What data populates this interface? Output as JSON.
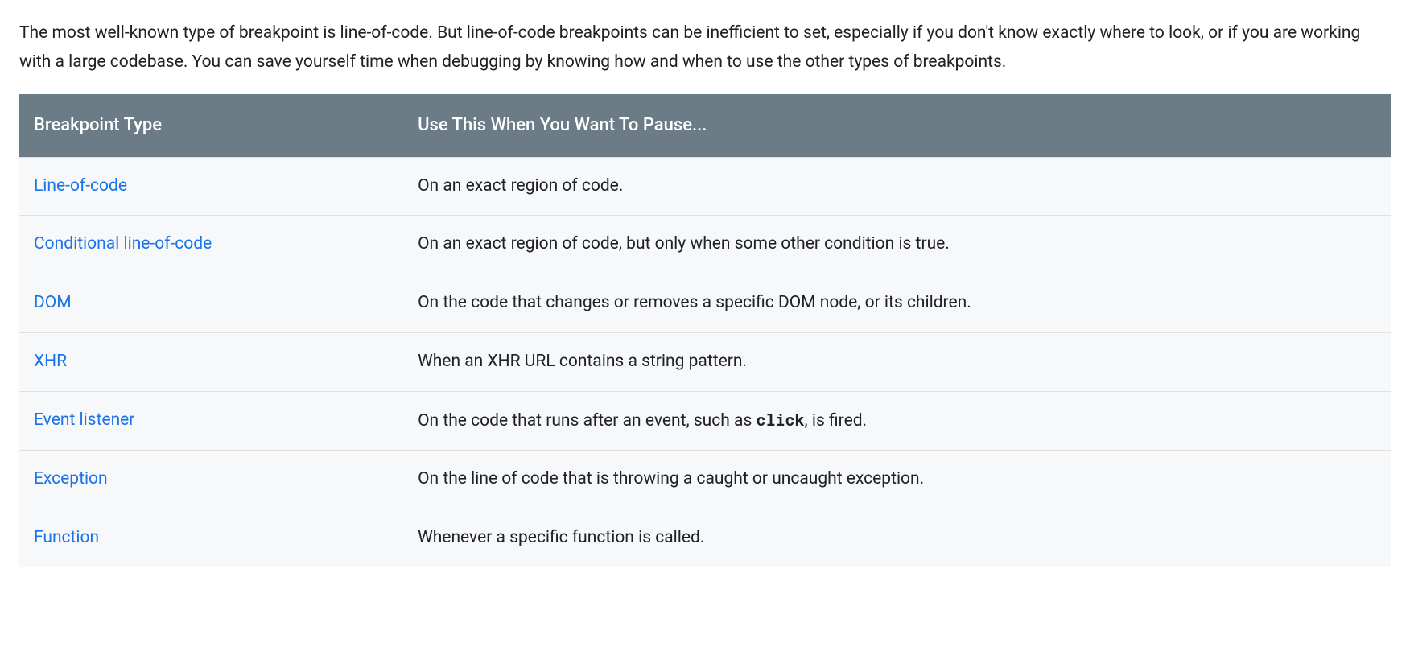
{
  "intro_text": "The most well-known type of breakpoint is line-of-code. But line-of-code breakpoints can be inefficient to set, especially if you don't know exactly where to look, or if you are working with a large codebase. You can save yourself time when debugging by knowing how and when to use the other types of breakpoints.",
  "table": {
    "header_type": "Breakpoint Type",
    "header_when": "Use This When You Want To Pause...",
    "rows": [
      {
        "type": "Line-of-code",
        "desc": "On an exact region of code."
      },
      {
        "type": "Conditional line-of-code",
        "desc": "On an exact region of code, but only when some other condition is true."
      },
      {
        "type": "DOM",
        "desc": "On the code that changes or removes a specific DOM node, or its children."
      },
      {
        "type": "XHR",
        "desc": "When an XHR URL contains a string pattern."
      },
      {
        "type": "Event listener",
        "desc_pre": "On the code that runs after an event, such as ",
        "desc_code": "click",
        "desc_post": ", is fired."
      },
      {
        "type": "Exception",
        "desc": "On the line of code that is throwing a caught or uncaught exception."
      },
      {
        "type": "Function",
        "desc": "Whenever a specific function is called."
      }
    ]
  }
}
